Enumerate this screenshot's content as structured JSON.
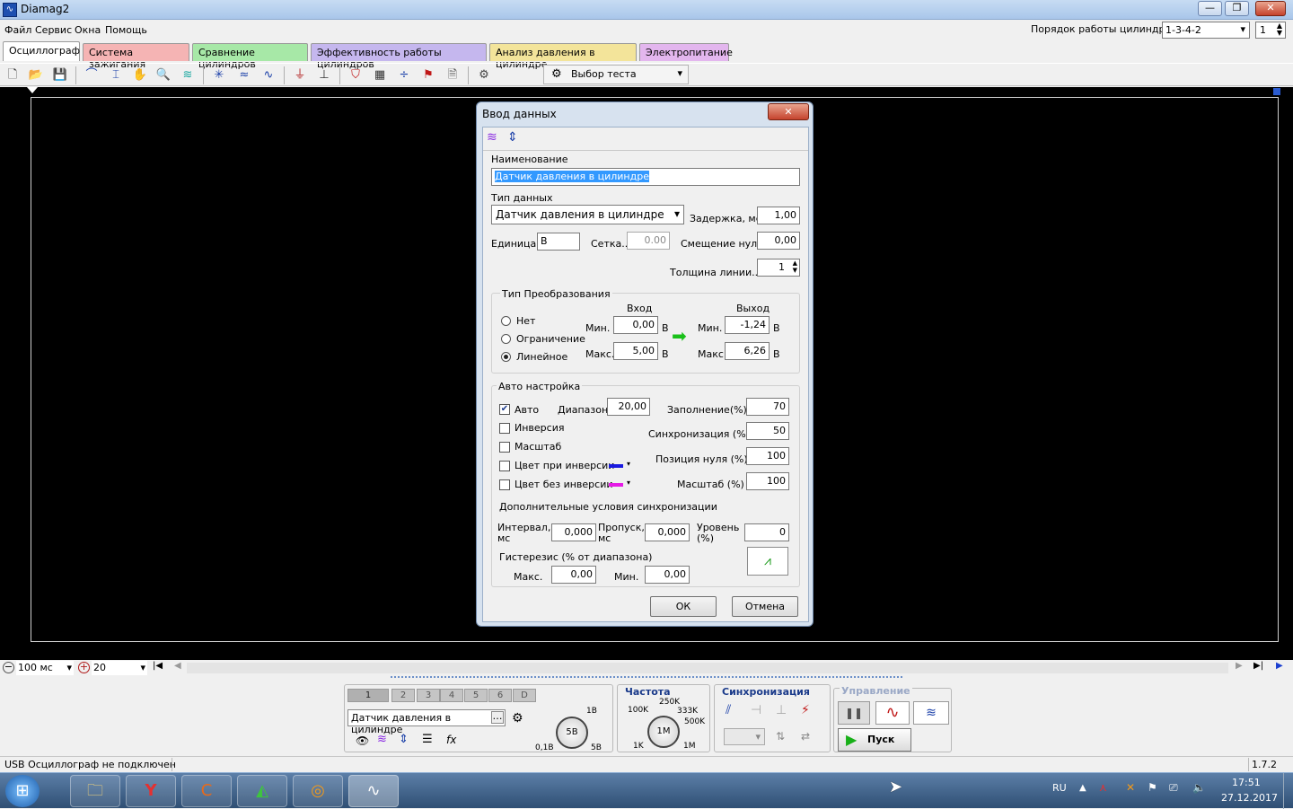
{
  "window": {
    "title": "Diamag2",
    "minimize": "—",
    "maximize": "❐",
    "close": "✕"
  },
  "menu": [
    "Файл",
    "Сервис",
    "Окна",
    "Помощь"
  ],
  "cylinder_order": {
    "label": "Порядок работы цилиндров",
    "value": "1-3-4-2",
    "spin": "1"
  },
  "tabs": [
    "Осциллограф",
    "Система зажигания",
    "Сравнение цилиндров",
    "Эффективность работы цилиндров",
    "Анализ давления в цилиндре",
    "Электропитание"
  ],
  "toolbar": {
    "test_select": "Выбор теста"
  },
  "bottombar": {
    "time": "100 мс",
    "count": "20"
  },
  "panel": {
    "channels": [
      "1",
      "2",
      "3",
      "4",
      "5",
      "6",
      "D"
    ],
    "channel_name": "Датчик давления в цилиндре",
    "voltage": {
      "center": "5В",
      "top": "1В",
      "left": "0,1В",
      "right": "5В"
    },
    "freq": {
      "label": "Частота",
      "center": "1М",
      "k100": "100K",
      "k250": "250K",
      "k333": "333K",
      "k500": "500K",
      "k1": "1K",
      "m1": "1M"
    },
    "sync_label": "Синхронизация",
    "control_label": "Управление",
    "start": "Пуск"
  },
  "status": {
    "left": "USB Осциллограф не подключен",
    "version": "1.7.2"
  },
  "tray": {
    "lang": "RU",
    "time": "17:51",
    "date": "27.12.2017"
  },
  "dialog": {
    "title": "Ввод данных",
    "name_label": "Наименование",
    "name_value": "Датчик давления в цилиндре",
    "type_label": "Тип данных",
    "type_value": "Датчик давления в цилиндре",
    "delay_label": "Задержка, мс",
    "delay_value": "1,00",
    "unit_label": "Единица..",
    "unit_value": "В",
    "grid_label": "Сетка..",
    "grid_value": "0.00",
    "offset_label": "Смещение нуля",
    "offset_value": "0,00",
    "line_label": "Толщина линии...",
    "line_value": "1",
    "conv": {
      "title": "Тип Преобразования",
      "in_label": "Вход",
      "out_label": "Выход",
      "opt_none": "Нет",
      "opt_limit": "Ограничение",
      "opt_linear": "Линейное",
      "min": "Мин.",
      "max": "Макс.",
      "unit": "В",
      "in_min": "0,00",
      "in_max": "5,00",
      "out_min": "-1,24",
      "out_max": "6,26"
    },
    "auto": {
      "title": "Авто настройка",
      "auto": "Авто",
      "invert": "Инверсия",
      "scale": "Масштаб",
      "color_inv": "Цвет при инверсии",
      "color_noinv": "Цвет без инверсии",
      "range_label": "Диапазон..",
      "range_value": "20,00",
      "fill_label": "Заполнение(%)",
      "fill_value": "70",
      "sync_label": "Синхронизация (%)",
      "sync_value": "50",
      "zero_label": "Позиция нуля (%)",
      "zero_value": "100",
      "scale_label": "Масштаб (%)",
      "scale_value": "100",
      "extra_title": "Дополнительные условия синхронизации",
      "interval_label": "Интервал, мс",
      "interval_value": "0,000",
      "skip_label": "Пропуск, мс",
      "skip_value": "0,000",
      "level_label": "Уровень (%)",
      "level_value": "0",
      "hyst_title": "Гистерезис (% от диапазона)",
      "hyst_max_label": "Макс.",
      "hyst_max_value": "0,00",
      "hyst_min_label": "Мин.",
      "hyst_min_value": "0,00"
    },
    "ok": "ОК",
    "cancel": "Отмена"
  }
}
